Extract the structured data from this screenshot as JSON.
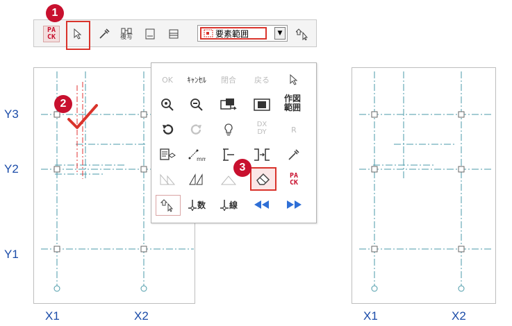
{
  "toolbar": {
    "pack_top": "PA",
    "pack_bottom": "CK",
    "copy_label": "複写",
    "scope_value": "要素範囲"
  },
  "callouts": [
    "1",
    "2",
    "3"
  ],
  "left_drawing": {
    "row_labels": [
      "Y3",
      "Y2",
      "Y1"
    ],
    "col_labels": [
      "X1",
      "X2"
    ]
  },
  "right_drawing": {
    "col_labels": [
      "X1",
      "X2"
    ]
  },
  "palette": {
    "row1": {
      "ok": "OK",
      "cancel": "ｷｬﾝｾﾙ",
      "close": "閉合",
      "back": "戻る"
    },
    "row2": {
      "draw_range_1": "作図",
      "draw_range_2": "範囲"
    },
    "row3": {
      "dxdy_1": "DX",
      "dxdy_2": "DY",
      "r": "R"
    },
    "row4": {
      "mm": "mm"
    },
    "row5": {
      "pack_top": "PA",
      "pack_bottom": "CK"
    },
    "row6": {
      "num": "数",
      "line": "線"
    }
  },
  "colors": {
    "accent_red": "#c8102e",
    "axis_blue": "#1a4ba8",
    "grid_line": "#4a9aa8",
    "nav_blue": "#2f6fd6"
  }
}
